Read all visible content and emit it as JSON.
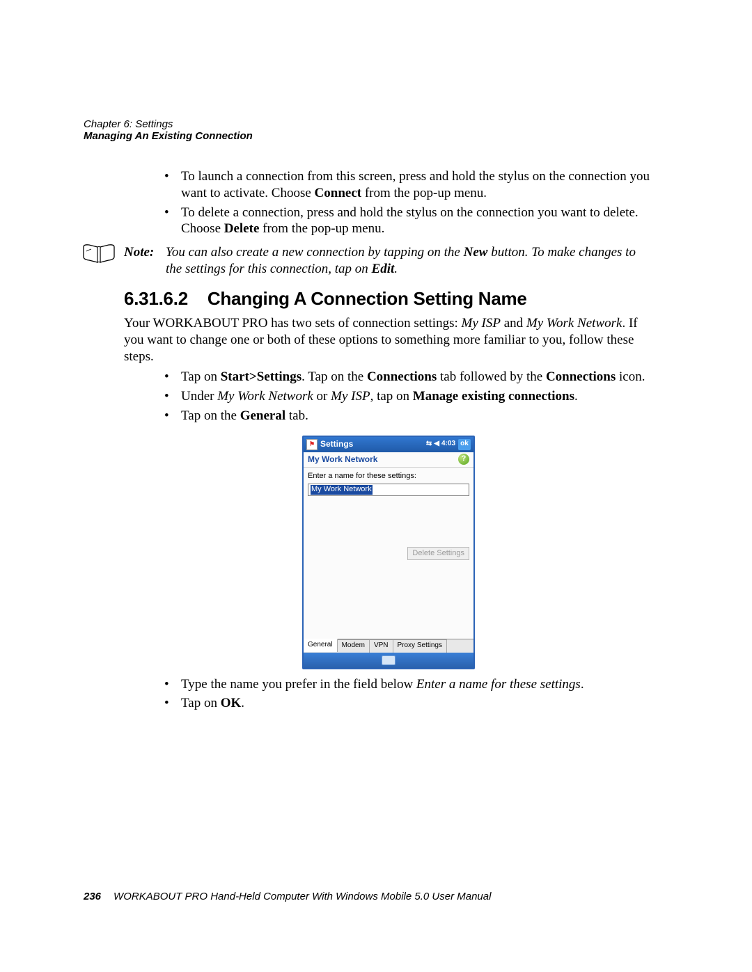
{
  "header": {
    "chapter": "Chapter 6: Settings",
    "section": "Managing An Existing Connection"
  },
  "bullets_top": [
    {
      "pre": "To launch a connection from this screen, press and hold the stylus on the connection you want to activate. Choose ",
      "bold": "Connect",
      "post": " from the pop-up menu."
    },
    {
      "pre": "To delete a connection, press and hold the stylus on the connection you want to delete. Choose ",
      "bold": "Delete",
      "post": " from the pop-up menu."
    }
  ],
  "note": {
    "label": "Note:",
    "t1": "You can also create a new connection by tapping on the ",
    "b1": "New",
    "t2": " button. To make changes to the settings for this connection, tap on ",
    "b2": "Edit",
    "t3": "."
  },
  "heading": {
    "num": "6.31.6.2",
    "title": "Changing A Connection Setting Name"
  },
  "para1": {
    "t1": "Your WORKABOUT PRO has two sets of connection settings: ",
    "i1": "My ISP",
    "t2": " and ",
    "i2": "My Work Network",
    "t3": ". If you want to change one or both of these options to something more familiar to you, follow these steps."
  },
  "bullets_mid": [
    {
      "t1": "Tap on ",
      "b1": "Start>Settings",
      "t2": ". Tap on the ",
      "b2": "Connections",
      "t3": " tab followed by the ",
      "b3": "Connections",
      "t4": " icon."
    },
    {
      "t1": "Under ",
      "i1": "My Work Network",
      "t2": " or ",
      "i2": "My ISP",
      "t3": ", tap on ",
      "b1": "Manage existing connections",
      "t4": "."
    },
    {
      "t1": "Tap on the ",
      "b1": "General",
      "t2": " tab."
    }
  ],
  "wm": {
    "title": "Settings",
    "time": "4:03",
    "ok": "ok",
    "subtitle": "My Work Network",
    "field_label": "Enter a name for these settings:",
    "field_value": "My Work Network",
    "delete_btn": "Delete Settings",
    "tabs": [
      "General",
      "Modem",
      "VPN",
      "Proxy Settings"
    ]
  },
  "bullets_bottom": [
    {
      "t1": "Type the name you prefer in the field below ",
      "i1": "Enter a name for these settings",
      "t2": "."
    },
    {
      "t1": "Tap on ",
      "b1": "OK",
      "t2": "."
    }
  ],
  "footer": {
    "page": "236",
    "text": "WORKABOUT PRO Hand-Held Computer With Windows Mobile 5.0 User Manual"
  }
}
